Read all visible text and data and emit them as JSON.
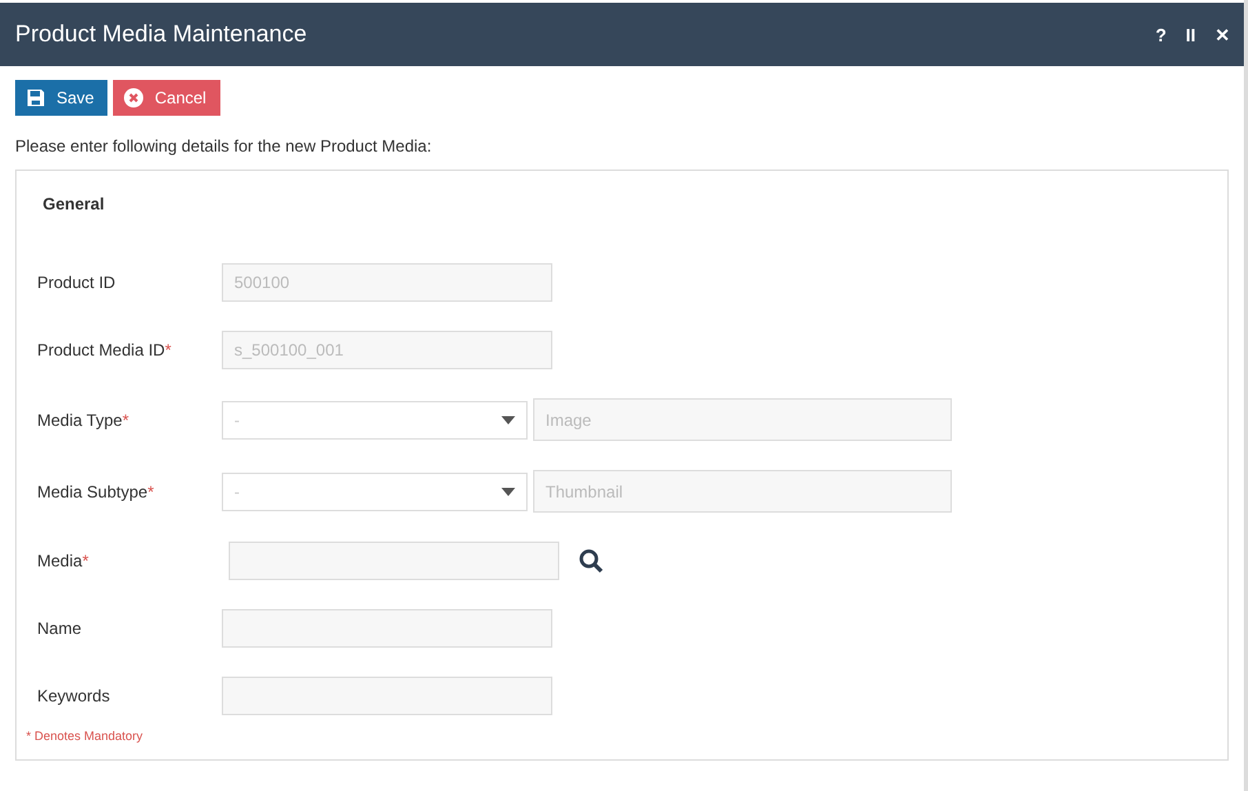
{
  "window": {
    "title": "Product Media Maintenance",
    "controls": [
      "?",
      "II",
      "✕"
    ]
  },
  "buttons": [
    {
      "kind": "save",
      "label": "Save"
    },
    {
      "kind": "cancel",
      "label": "Cancel"
    }
  ],
  "intro": "Please enter following details for the new Product Media:",
  "section": {
    "title": "General",
    "fields": [
      {
        "kind": "text",
        "label": "Product ID",
        "value": "500100"
      },
      {
        "kind": "text",
        "label": "Product Media ID",
        "mark": "*",
        "value": "s_500100_001"
      },
      {
        "kind": "select",
        "label": "Media Type",
        "mark": "*",
        "value": "-",
        "detail": "Image"
      },
      {
        "kind": "select",
        "label": "Media Subtype",
        "mark": "*",
        "value": "-",
        "detail": "Thumbnail"
      },
      {
        "kind": "lookup",
        "label": "Media",
        "mark": "*"
      },
      {
        "kind": "text",
        "label": "Name"
      },
      {
        "kind": "text",
        "label": "Keywords"
      }
    ],
    "note": "* Denotes Mandatory"
  }
}
